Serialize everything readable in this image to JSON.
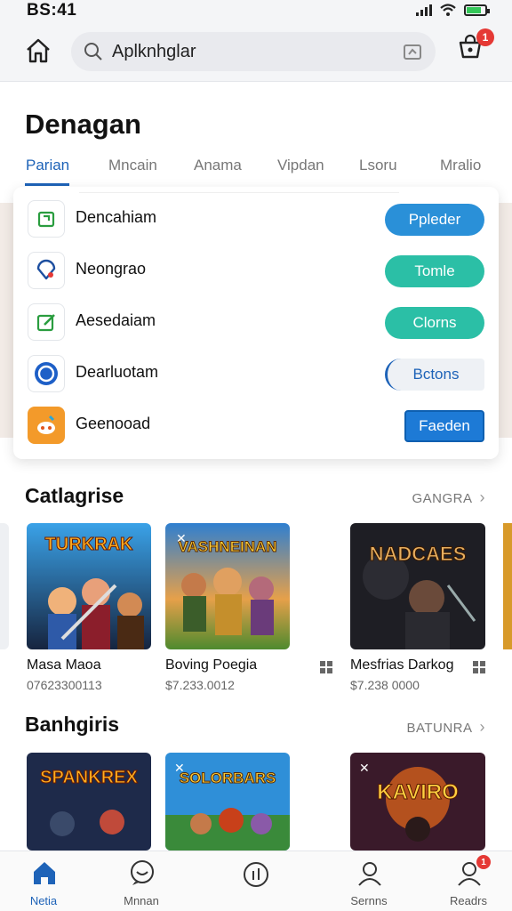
{
  "status_bar": {
    "time": "BS:41"
  },
  "top_bar": {
    "search_text": "Aplknhglar",
    "cart_badge": "1",
    "home_icon": "home-icon",
    "search_icon": "search-icon",
    "scan_icon": "scan-icon",
    "cart_icon": "cart-icon"
  },
  "page": {
    "title": "Denagan"
  },
  "tabs": [
    "Parian",
    "Mncain",
    "Anama",
    "Vipdan",
    "Lsoru",
    "Mralio"
  ],
  "list": [
    {
      "label": "Dencahiam",
      "button": "Ppleder",
      "icon": "square-arrow-icon"
    },
    {
      "label": "Neongrao",
      "button": "Tomle",
      "icon": "map-pin-icon"
    },
    {
      "label": "Aesedaiam",
      "button": "Clorns",
      "icon": "edit-icon"
    },
    {
      "label": "Dearluotam",
      "button": "Bctons",
      "icon": "circle-icon"
    },
    {
      "label": "Geenooad",
      "button": "Faeden",
      "icon": "game-app-icon"
    }
  ],
  "section1": {
    "title": "Catlagrise",
    "see_all": "GANGRA",
    "items": [
      {
        "name": "Masa Maoa",
        "price": "07623300113",
        "art_title": "TURKRAK"
      },
      {
        "name": "Boving Poegia",
        "price": "$7.233.0012",
        "art_title": "VASHNEINAN"
      },
      {
        "name": "Mesfrias Darkog",
        "price": "$7.238 0000",
        "art_title": "NADCAES"
      }
    ]
  },
  "section2": {
    "title": "Banhgiris",
    "see_all": "BATUNRA",
    "items": [
      {
        "art_title": "SPANKREX"
      },
      {
        "art_title": "SOLORBARS"
      },
      {
        "art_title": "KAVIRO"
      }
    ]
  },
  "bottom_nav": [
    {
      "label": "Netia",
      "icon": "home-icon"
    },
    {
      "label": "Mnnan",
      "icon": "chat-icon"
    },
    {
      "label": "",
      "icon": "stats-icon"
    },
    {
      "label": "Sernns",
      "icon": "person-icon"
    },
    {
      "label": "Readrs",
      "icon": "profile-icon",
      "badge": "1"
    }
  ],
  "colors": {
    "accent": "#1e63b8",
    "teal": "#2bbfa6",
    "blue": "#2a90d8",
    "badge": "#e53935"
  }
}
